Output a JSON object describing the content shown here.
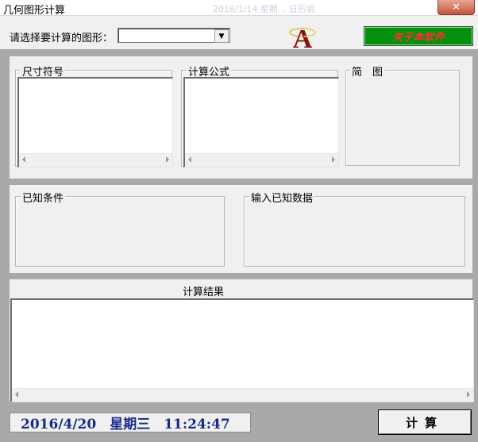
{
  "window": {
    "title": "几何图形计算",
    "background_hint": "2016/1/14 星期... 日历说",
    "close_glyph": "✕"
  },
  "top": {
    "shape_label": "请选择要计算的图形：",
    "shape_select_value": "",
    "about_button": "关于本软件",
    "logo_letter": "A"
  },
  "groups": {
    "size_symbols": "尺寸符号",
    "formula": "计算公式",
    "diagram": "简　图",
    "known_conditions": "已知条件",
    "input_known_data": "输入已知数据",
    "result": "计算结果"
  },
  "bottom": {
    "datetime": "2016/4/20　星期三　11:24:47",
    "compute_button": "计算"
  },
  "colors": {
    "about_bg": "#058f0e",
    "about_text": "#ff3030",
    "datetime_text": "#1a2a8c",
    "close_bg": "#c6533c"
  }
}
